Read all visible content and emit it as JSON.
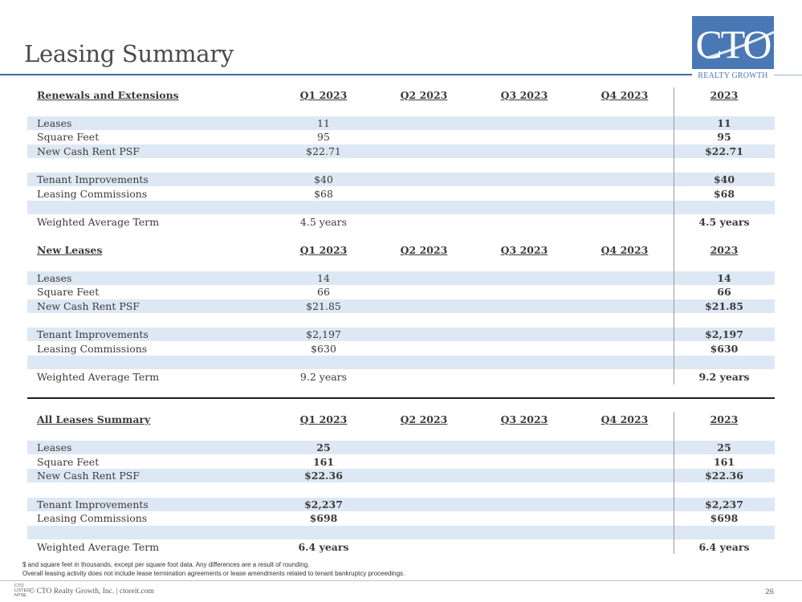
{
  "page": {
    "title": "Leasing Summary",
    "logo": {
      "text": "CTO",
      "subtitle": "REALTY GROWTH"
    },
    "columns": [
      "Q1 2023",
      "Q2 2023",
      "Q3 2023",
      "Q4 2023",
      "2023"
    ]
  },
  "renewals": {
    "heading": "Renewals and Extensions",
    "rows": [
      {
        "label": "Leases",
        "q1": "11",
        "q2": "",
        "q3": "",
        "q4": "",
        "year": "11"
      },
      {
        "label": "Square Feet",
        "q1": "95",
        "q2": "",
        "q3": "",
        "q4": "",
        "year": "95"
      },
      {
        "label": "New Cash Rent PSF",
        "q1": "$22.71",
        "q2": "",
        "q3": "",
        "q4": "",
        "year": "$22.71"
      },
      {
        "label": "Tenant Improvements",
        "q1": "$40",
        "q2": "",
        "q3": "",
        "q4": "",
        "year": "$40"
      },
      {
        "label": "Leasing Commissions",
        "q1": "$68",
        "q2": "",
        "q3": "",
        "q4": "",
        "year": "$68"
      },
      {
        "label": "Weighted Average Term",
        "q1": "4.5 years",
        "q2": "",
        "q3": "",
        "q4": "",
        "year": "4.5 years"
      }
    ]
  },
  "new_leases": {
    "heading": "New Leases",
    "rows": [
      {
        "label": "Leases",
        "q1": "14",
        "q2": "",
        "q3": "",
        "q4": "",
        "year": "14"
      },
      {
        "label": "Square Feet",
        "q1": "66",
        "q2": "",
        "q3": "",
        "q4": "",
        "year": "66"
      },
      {
        "label": "New Cash Rent PSF",
        "q1": "$21.85",
        "q2": "",
        "q3": "",
        "q4": "",
        "year": "$21.85"
      },
      {
        "label": "Tenant Improvements",
        "q1": "$2,197",
        "q2": "",
        "q3": "",
        "q4": "",
        "year": "$2,197"
      },
      {
        "label": "Leasing Commissions",
        "q1": "$630",
        "q2": "",
        "q3": "",
        "q4": "",
        "year": "$630"
      },
      {
        "label": "Weighted Average Term",
        "q1": "9.2 years",
        "q2": "",
        "q3": "",
        "q4": "",
        "year": "9.2 years"
      }
    ]
  },
  "all_leases": {
    "heading": "All Leases Summary",
    "rows": [
      {
        "label": "Leases",
        "q1": "25",
        "q2": "",
        "q3": "",
        "q4": "",
        "year": "25"
      },
      {
        "label": "Square Feet",
        "q1": "161",
        "q2": "",
        "q3": "",
        "q4": "",
        "year": "161"
      },
      {
        "label": "New Cash Rent PSF",
        "q1": "$22.36",
        "q2": "",
        "q3": "",
        "q4": "",
        "year": "$22.36"
      },
      {
        "label": "Tenant Improvements",
        "q1": "$2,237",
        "q2": "",
        "q3": "",
        "q4": "",
        "year": "$2,237"
      },
      {
        "label": "Leasing Commissions",
        "q1": "$698",
        "q2": "",
        "q3": "",
        "q4": "",
        "year": "$698"
      },
      {
        "label": "Weighted Average Term",
        "q1": "6.4 years",
        "q2": "",
        "q3": "",
        "q4": "",
        "year": "6.4 years"
      }
    ]
  },
  "footnotes": [
    "$ and square feet in thousands, except per square foot data. Any differences are a result of rounding.",
    "Overall leasing activity does not include lease termination agreements or lease amendments related to tenant bankruptcy proceedings."
  ],
  "footer": {
    "logo_text": "CTO LISTED NYSE",
    "copyright": "© CTO Realty Growth, Inc. | ctoreit.com",
    "page_number": "26"
  },
  "colors": {
    "accent": "#4a78b5",
    "band": "#dde8f4",
    "rule": "#3f6aa3"
  }
}
